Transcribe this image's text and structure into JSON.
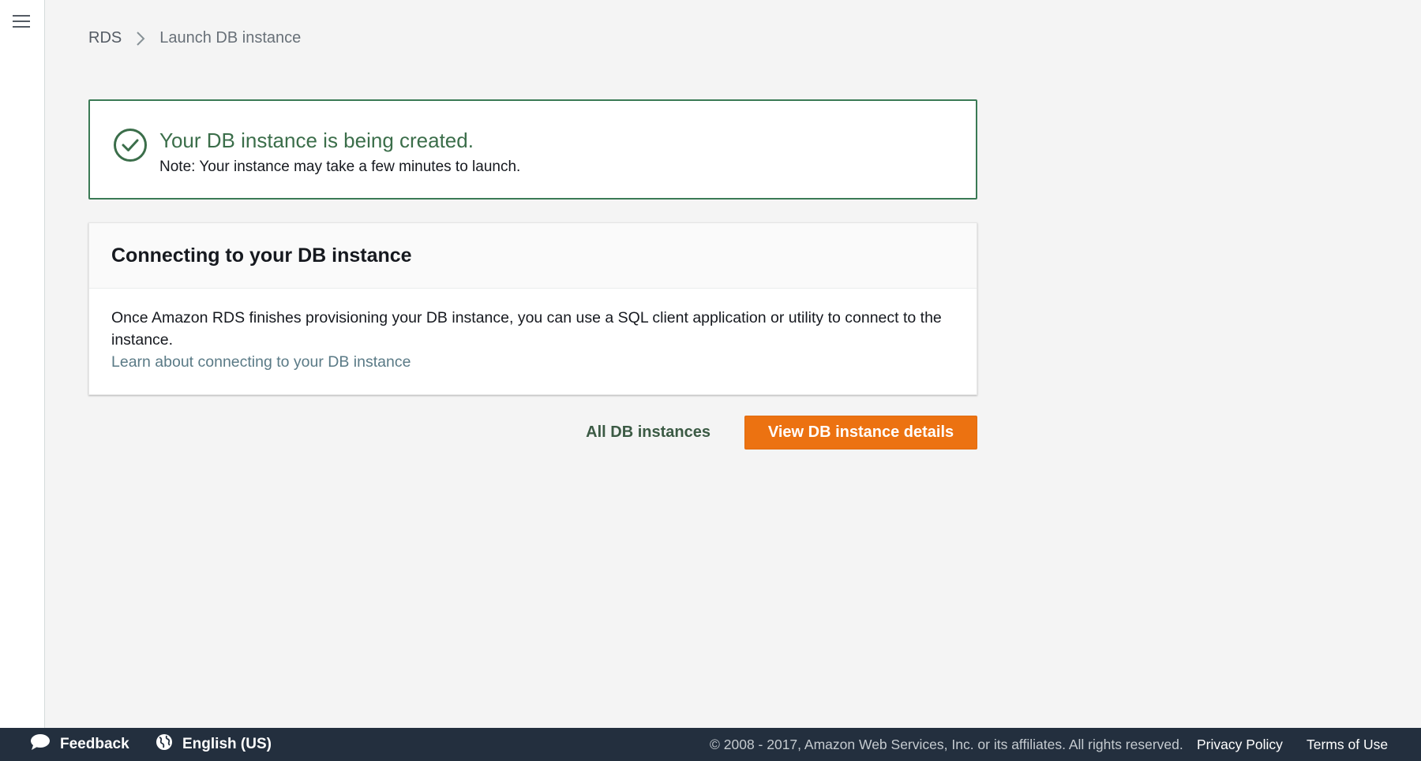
{
  "breadcrumb": {
    "root": "RDS",
    "current": "Launch DB instance"
  },
  "flash": {
    "title": "Your DB instance is being created.",
    "note": "Note: Your instance may take a few minutes to launch."
  },
  "panel": {
    "title": "Connecting to your DB instance",
    "body": "Once Amazon RDS finishes provisioning your DB instance, you can use a SQL client application or utility to connect to the instance.",
    "link": "Learn about connecting to your DB instance"
  },
  "actions": {
    "all_instances": "All DB instances",
    "view_details": "View DB instance details"
  },
  "footer": {
    "feedback": "Feedback",
    "language": "English (US)",
    "copyright": "© 2008 - 2017, Amazon Web Services, Inc. or its affiliates. All rights reserved.",
    "privacy": "Privacy Policy",
    "terms": "Terms of Use"
  },
  "colors": {
    "accent": "#ec7211",
    "success": "#3a7a55",
    "footer_bg": "#232f3e"
  },
  "icons": [
    "menu-icon",
    "chevron-right-icon",
    "check-circle-icon",
    "speech-bubble-icon",
    "globe-icon"
  ]
}
